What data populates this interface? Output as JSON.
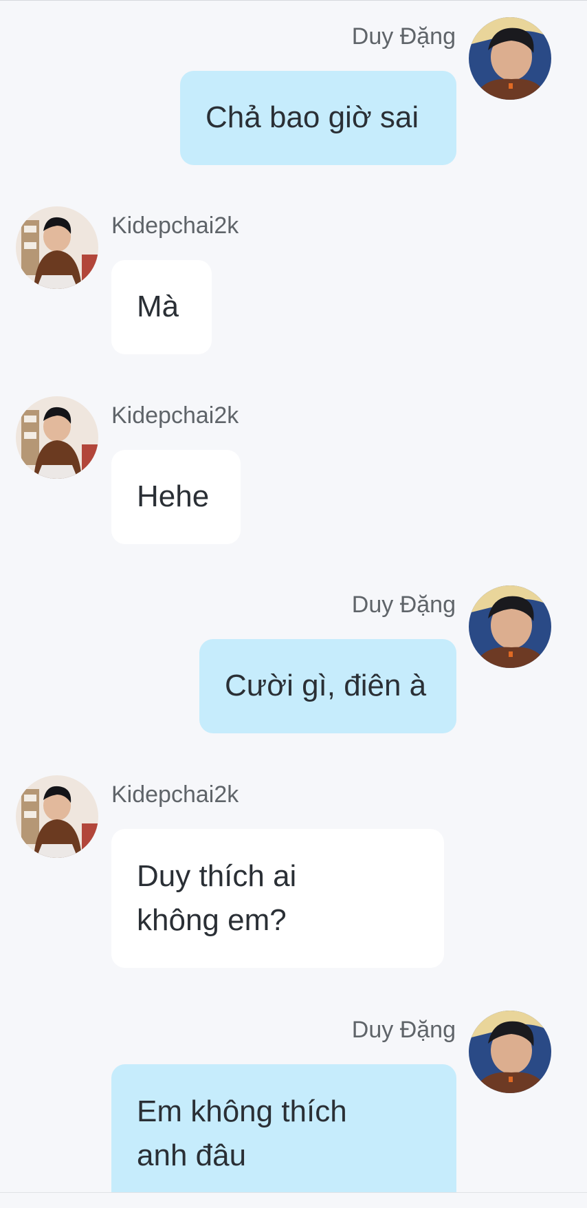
{
  "chat": {
    "messages": [
      {
        "id": "m1",
        "direction": "outgoing",
        "sender": "Duy Đặng",
        "lines": [
          "Chả bao giờ sai"
        ]
      },
      {
        "id": "m2",
        "direction": "incoming",
        "sender": "Kidepchai2k",
        "lines": [
          "Mà"
        ]
      },
      {
        "id": "m3",
        "direction": "incoming",
        "sender": "Kidepchai2k",
        "lines": [
          "Hehe"
        ]
      },
      {
        "id": "m4",
        "direction": "outgoing",
        "sender": "Duy Đặng",
        "lines": [
          "Cười gì, điên à"
        ]
      },
      {
        "id": "m5",
        "direction": "incoming",
        "sender": "Kidepchai2k",
        "lines": [
          "Duy thích ai",
          "không em?"
        ]
      },
      {
        "id": "m6",
        "direction": "outgoing",
        "sender": "Duy Đặng",
        "lines": [
          "Em không thích",
          "anh đâu"
        ]
      }
    ]
  },
  "colors": {
    "background": "#f6f7fa",
    "outgoing_bubble": "#c6ecfc",
    "incoming_bubble": "#ffffff",
    "sender_text": "#5f6469",
    "message_text": "#2a2f35"
  },
  "icons": {
    "outgoing_avatar": "avatar-duy-dang",
    "incoming_avatar": "avatar-kidepchai2k"
  }
}
